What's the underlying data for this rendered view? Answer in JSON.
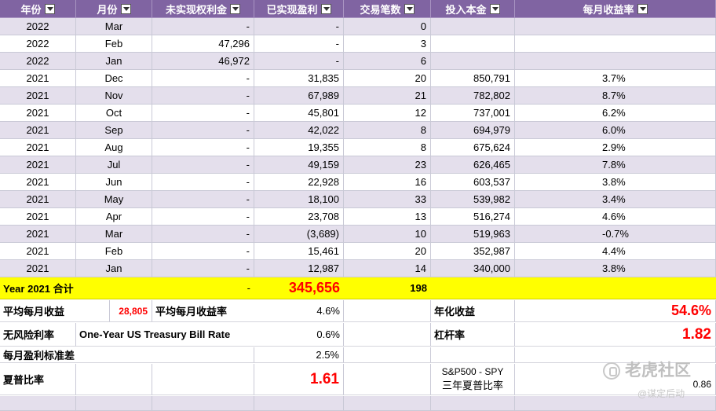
{
  "header": [
    "年份",
    "月份",
    "未实现权利金",
    "已实现盈利",
    "交易笔数",
    "投入本金",
    "每月收益率"
  ],
  "rows": [
    {
      "year": "2022",
      "month": "Mar",
      "unrealized": "-",
      "realized": "-",
      "trades": "0",
      "capital": "",
      "rate": ""
    },
    {
      "year": "2022",
      "month": "Feb",
      "unrealized": "47,296",
      "realized": "-",
      "trades": "3",
      "capital": "",
      "rate": ""
    },
    {
      "year": "2022",
      "month": "Jan",
      "unrealized": "46,972",
      "realized": "-",
      "trades": "6",
      "capital": "",
      "rate": ""
    },
    {
      "year": "2021",
      "month": "Dec",
      "unrealized": "-",
      "realized": "31,835",
      "trades": "20",
      "capital": "850,791",
      "rate": "3.7%"
    },
    {
      "year": "2021",
      "month": "Nov",
      "unrealized": "-",
      "realized": "67,989",
      "trades": "21",
      "capital": "782,802",
      "rate": "8.7%"
    },
    {
      "year": "2021",
      "month": "Oct",
      "unrealized": "-",
      "realized": "45,801",
      "trades": "12",
      "capital": "737,001",
      "rate": "6.2%"
    },
    {
      "year": "2021",
      "month": "Sep",
      "unrealized": "-",
      "realized": "42,022",
      "trades": "8",
      "capital": "694,979",
      "rate": "6.0%"
    },
    {
      "year": "2021",
      "month": "Aug",
      "unrealized": "-",
      "realized": "19,355",
      "trades": "8",
      "capital": "675,624",
      "rate": "2.9%"
    },
    {
      "year": "2021",
      "month": "Jul",
      "unrealized": "-",
      "realized": "49,159",
      "trades": "23",
      "capital": "626,465",
      "rate": "7.8%"
    },
    {
      "year": "2021",
      "month": "Jun",
      "unrealized": "-",
      "realized": "22,928",
      "trades": "16",
      "capital": "603,537",
      "rate": "3.8%"
    },
    {
      "year": "2021",
      "month": "May",
      "unrealized": "-",
      "realized": "18,100",
      "trades": "33",
      "capital": "539,982",
      "rate": "3.4%"
    },
    {
      "year": "2021",
      "month": "Apr",
      "unrealized": "-",
      "realized": "23,708",
      "trades": "13",
      "capital": "516,274",
      "rate": "4.6%"
    },
    {
      "year": "2021",
      "month": "Mar",
      "unrealized": "-",
      "realized": "(3,689)",
      "trades": "10",
      "capital": "519,963",
      "rate": "-0.7%"
    },
    {
      "year": "2021",
      "month": "Feb",
      "unrealized": "-",
      "realized": "15,461",
      "trades": "20",
      "capital": "352,987",
      "rate": "4.4%"
    },
    {
      "year": "2021",
      "month": "Jan",
      "unrealized": "-",
      "realized": "12,987",
      "trades": "14",
      "capital": "340,000",
      "rate": "3.8%"
    }
  ],
  "total": {
    "label": "Year 2021 合计",
    "unrealized": "-",
    "realized": "345,656",
    "trades": "198"
  },
  "summary": {
    "avg_monthly_profit_label": "平均每月收益",
    "avg_monthly_profit": "28,805",
    "avg_monthly_rate_label": "平均每月收益率",
    "avg_monthly_rate": "4.6%",
    "annual_return_label": "年化收益",
    "annual_return": "54.6%",
    "risk_free_label": "无风险利率",
    "risk_free_desc": "One-Year US Treasury Bill Rate",
    "risk_free": "0.6%",
    "leverage_label": "杠杆率",
    "leverage": "1.82",
    "std_label": "每月盈利标准差",
    "std": "2.5%",
    "sharpe_label": "夏普比率",
    "sharpe": "1.61",
    "spy_label1": "S&P500 - SPY",
    "spy_label2": "三年夏普比率",
    "spy_sharpe": "0.86"
  },
  "watermark": {
    "main": "老虎社区",
    "sub": "@谋定后动"
  }
}
